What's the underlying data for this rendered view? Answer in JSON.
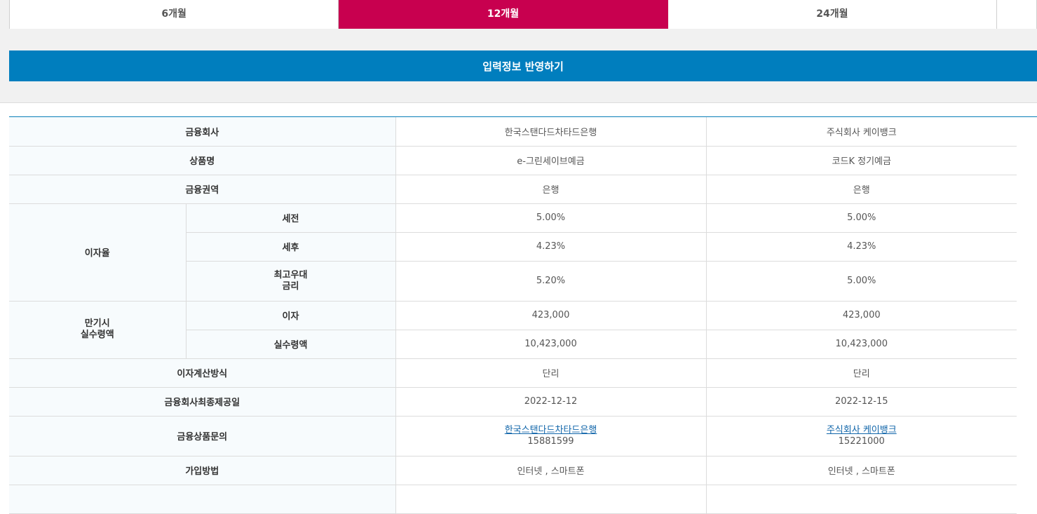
{
  "tabs": [
    {
      "label": "6개월",
      "active": false
    },
    {
      "label": "12개월",
      "active": true
    },
    {
      "label": "24개월",
      "active": false
    }
  ],
  "apply_button": "입력정보 반영하기",
  "table": {
    "row_labels": {
      "company": "금융회사",
      "product": "상품명",
      "sector": "금융권역",
      "interest_rate": "이자율",
      "pre_tax": "세전",
      "after_tax": "세후",
      "max_pref_line1": "최고우대",
      "max_pref_line2": "금리",
      "maturity_line1": "만기시",
      "maturity_line2": "실수령액",
      "interest": "이자",
      "received": "실수령액",
      "calc_method": "이자계산방식",
      "disclosure_date": "금융회사최종제공일",
      "inquiry": "금융상품문의",
      "join_method": "가입방법"
    },
    "columns": [
      {
        "company": "한국스탠다드차타드은행",
        "product": "e-그린세이브예금",
        "sector": "은행",
        "pre_tax": "5.00%",
        "after_tax": "4.23%",
        "max_pref": "5.20%",
        "interest": "423,000",
        "received": "10,423,000",
        "calc_method": "단리",
        "disclosure_date": "2022-12-12",
        "inquiry_link": "한국스탠다드차타드은행",
        "inquiry_phone": "15881599",
        "join_method": "인터넷 , 스마트폰"
      },
      {
        "company": "주식회사 케이뱅크",
        "product": "코드K 정기예금",
        "sector": "은행",
        "pre_tax": "5.00%",
        "after_tax": "4.23%",
        "max_pref": "5.00%",
        "interest": "423,000",
        "received": "10,423,000",
        "calc_method": "단리",
        "disclosure_date": "2022-12-15",
        "inquiry_link": "주식회사 케이뱅크",
        "inquiry_phone": "15221000",
        "join_method": "인터넷 , 스마트폰"
      }
    ]
  }
}
